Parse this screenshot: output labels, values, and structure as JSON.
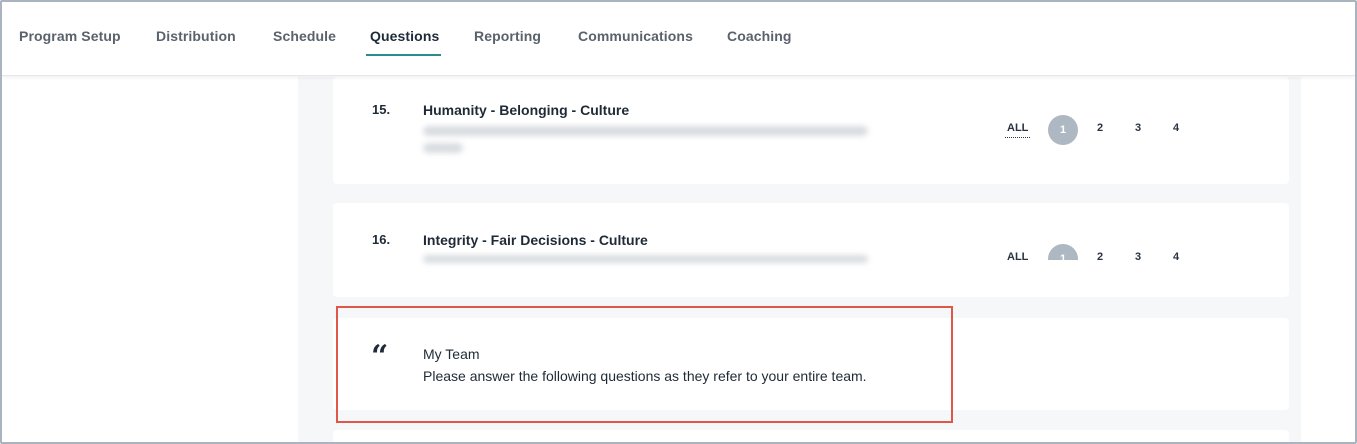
{
  "nav": {
    "tabs": [
      {
        "label": "Program Setup"
      },
      {
        "label": "Distribution"
      },
      {
        "label": "Schedule"
      },
      {
        "label": "Questions"
      },
      {
        "label": "Reporting"
      },
      {
        "label": "Communications"
      },
      {
        "label": "Coaching"
      }
    ],
    "active_tab": "Questions"
  },
  "questions": [
    {
      "number": "15.",
      "title": "Humanity - Belonging - Culture",
      "scale": {
        "all_label": "ALL",
        "options": [
          "1",
          "2",
          "3",
          "4"
        ],
        "selected": "1"
      }
    },
    {
      "number": "16.",
      "title": "Integrity - Fair Decisions - Culture",
      "scale": {
        "all_label": "ALL",
        "options": [
          "1",
          "2",
          "3",
          "4"
        ],
        "selected": "1"
      }
    }
  ],
  "section": {
    "icon": "quote-icon",
    "glyph": "“",
    "title": "My Team",
    "description": "Please answer the following questions as they refer to your entire team."
  },
  "colors": {
    "accent": "#2f8a8c",
    "highlight_border": "#e0574a",
    "selected_circle": "#aeb8c3",
    "content_bg": "#f6f7f9"
  }
}
